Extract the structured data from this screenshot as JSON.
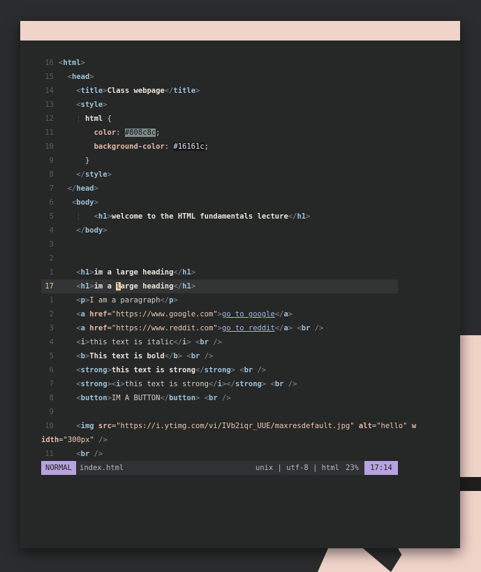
{
  "statusbar": {
    "mode": "NORMAL",
    "filename": "index.html",
    "fileinfo": "unix | utf-8 | html",
    "percent": "23%",
    "position": "17:14"
  },
  "lines": [
    {
      "n": "16",
      "segs": [
        [
          "b",
          "<"
        ],
        [
          "t",
          "html"
        ],
        [
          "b",
          ">"
        ]
      ],
      "indent": 0
    },
    {
      "n": "15",
      "segs": [
        [
          "b",
          "<"
        ],
        [
          "t",
          "head"
        ],
        [
          "b",
          ">"
        ]
      ],
      "indent": 2
    },
    {
      "n": "14",
      "segs": [
        [
          "b",
          "<"
        ],
        [
          "t",
          "title"
        ],
        [
          "b",
          ">"
        ],
        [
          "x",
          "Class webpage"
        ],
        [
          "b",
          "</"
        ],
        [
          "t",
          "title"
        ],
        [
          "b",
          ">"
        ]
      ],
      "indent": 4
    },
    {
      "n": "13",
      "segs": [
        [
          "b",
          "<"
        ],
        [
          "t",
          "style"
        ],
        [
          "b",
          ">"
        ]
      ],
      "indent": 4
    },
    {
      "n": "12",
      "segs": [
        [
          "guide",
          "¦ "
        ],
        [
          "x",
          "html"
        ],
        [
          "p",
          " {"
        ]
      ],
      "indent": 4
    },
    {
      "n": "11",
      "segs": [
        [
          "a",
          "color"
        ],
        [
          "p",
          ": "
        ],
        [
          "gray-hl",
          "#808c8c"
        ],
        [
          "p",
          ";"
        ]
      ],
      "indent": 8
    },
    {
      "n": "10",
      "segs": [
        [
          "a",
          "background-color"
        ],
        [
          "p",
          ": "
        ],
        [
          "dark-hl",
          "#16161c"
        ],
        [
          "p",
          ";"
        ]
      ],
      "indent": 8
    },
    {
      "n": "9",
      "segs": [
        [
          "p",
          "}"
        ]
      ],
      "indent": 6
    },
    {
      "n": "8",
      "segs": [
        [
          "b",
          "</"
        ],
        [
          "t",
          "style"
        ],
        [
          "b",
          ">"
        ]
      ],
      "indent": 4
    },
    {
      "n": "7",
      "segs": [
        [
          "b",
          "</"
        ],
        [
          "t",
          "head"
        ],
        [
          "b",
          ">"
        ]
      ],
      "indent": 2
    },
    {
      "n": "6",
      "segs": [
        [
          "b",
          "<"
        ],
        [
          "t",
          "body"
        ],
        [
          "b",
          ">"
        ]
      ],
      "indent": 3
    },
    {
      "n": "5",
      "segs": [
        [
          "guide",
          "¦   "
        ],
        [
          "b",
          "<"
        ],
        [
          "t",
          "h1"
        ],
        [
          "b",
          ">"
        ],
        [
          "x",
          "welcome to the HTML fundamentals lecture"
        ],
        [
          "b",
          "</"
        ],
        [
          "t",
          "h1"
        ],
        [
          "b",
          ">"
        ]
      ],
      "indent": 4
    },
    {
      "n": "4",
      "segs": [
        [
          "b",
          "</"
        ],
        [
          "t",
          "body"
        ],
        [
          "b",
          ">"
        ]
      ],
      "indent": 4
    },
    {
      "n": "3",
      "segs": [],
      "indent": 0
    },
    {
      "n": "2",
      "segs": [],
      "indent": 0
    },
    {
      "n": "1",
      "segs": [
        [
          "b",
          "<"
        ],
        [
          "t",
          "h1"
        ],
        [
          "b",
          ">"
        ],
        [
          "x",
          "im a large heading"
        ],
        [
          "b",
          "</"
        ],
        [
          "t",
          "h1"
        ],
        [
          "b",
          ">"
        ]
      ],
      "indent": 4
    },
    {
      "n": "17",
      "cur": true,
      "segs": [
        [
          "b",
          "<"
        ],
        [
          "t",
          "h1"
        ],
        [
          "b",
          ">"
        ],
        [
          "x",
          "im a "
        ],
        [
          "cursor",
          "l"
        ],
        [
          "x",
          "arge heading"
        ],
        [
          "b",
          "</"
        ],
        [
          "t",
          "h1"
        ],
        [
          "b",
          ">"
        ]
      ],
      "indent": 4
    },
    {
      "n": "1",
      "segs": [
        [
          "b",
          "<"
        ],
        [
          "t",
          "p"
        ],
        [
          "b",
          ">"
        ],
        [
          "p",
          "I am a paragraph"
        ],
        [
          "b",
          "</"
        ],
        [
          "t",
          "p"
        ],
        [
          "b",
          ">"
        ]
      ],
      "indent": 4
    },
    {
      "n": "2",
      "segs": [
        [
          "b",
          "<"
        ],
        [
          "t",
          "a "
        ],
        [
          "a",
          "href"
        ],
        [
          "p",
          "="
        ],
        [
          "s",
          "\"https://www.google.com\""
        ],
        [
          "b",
          ">"
        ],
        [
          "lk",
          "go to google"
        ],
        [
          "b",
          "</"
        ],
        [
          "t",
          "a"
        ],
        [
          "b",
          ">"
        ]
      ],
      "indent": 4
    },
    {
      "n": "3",
      "segs": [
        [
          "b",
          "<"
        ],
        [
          "t",
          "a "
        ],
        [
          "a",
          "href"
        ],
        [
          "p",
          "="
        ],
        [
          "s",
          "\"https://www.reddit.com\""
        ],
        [
          "b",
          ">"
        ],
        [
          "lk",
          "go to reddit"
        ],
        [
          "b",
          "</"
        ],
        [
          "t",
          "a"
        ],
        [
          "b",
          "> "
        ],
        [
          "b",
          "<"
        ],
        [
          "t",
          "br"
        ],
        [
          "b",
          " />"
        ]
      ],
      "indent": 4
    },
    {
      "n": "4",
      "segs": [
        [
          "b",
          "<"
        ],
        [
          "t",
          "i"
        ],
        [
          "b",
          ">"
        ],
        [
          "p",
          "this text is italic"
        ],
        [
          "b",
          "</"
        ],
        [
          "t",
          "i"
        ],
        [
          "b",
          "> "
        ],
        [
          "b",
          "<"
        ],
        [
          "t",
          "br"
        ],
        [
          "b",
          " />"
        ]
      ],
      "indent": 4
    },
    {
      "n": "5",
      "segs": [
        [
          "b",
          "<"
        ],
        [
          "t",
          "b"
        ],
        [
          "b",
          ">"
        ],
        [
          "x",
          "This text is bold"
        ],
        [
          "b",
          "</"
        ],
        [
          "t",
          "b"
        ],
        [
          "b",
          "> "
        ],
        [
          "b",
          "<"
        ],
        [
          "t",
          "br"
        ],
        [
          "b",
          " />"
        ]
      ],
      "indent": 4
    },
    {
      "n": "6",
      "segs": [
        [
          "b",
          "<"
        ],
        [
          "t",
          "strong"
        ],
        [
          "b",
          ">"
        ],
        [
          "x",
          "this text is strong"
        ],
        [
          "b",
          "</"
        ],
        [
          "t",
          "strong"
        ],
        [
          "b",
          "> "
        ],
        [
          "b",
          "<"
        ],
        [
          "t",
          "br"
        ],
        [
          "b",
          " />"
        ]
      ],
      "indent": 4
    },
    {
      "n": "7",
      "segs": [
        [
          "b",
          "<"
        ],
        [
          "t",
          "strong"
        ],
        [
          "b",
          "><"
        ],
        [
          "t",
          "i"
        ],
        [
          "b",
          ">"
        ],
        [
          "p",
          "this text is strong"
        ],
        [
          "b",
          "</"
        ],
        [
          "t",
          "i"
        ],
        [
          "b",
          "></"
        ],
        [
          "t",
          "strong"
        ],
        [
          "b",
          "> "
        ],
        [
          "b",
          "<"
        ],
        [
          "t",
          "br"
        ],
        [
          "b",
          " />"
        ]
      ],
      "indent": 4
    },
    {
      "n": "8",
      "segs": [
        [
          "b",
          "<"
        ],
        [
          "t",
          "button"
        ],
        [
          "b",
          ">"
        ],
        [
          "p",
          "IM A BUTTON"
        ],
        [
          "b",
          "</"
        ],
        [
          "t",
          "button"
        ],
        [
          "b",
          "> "
        ],
        [
          "b",
          "<"
        ],
        [
          "t",
          "br"
        ],
        [
          "b",
          " />"
        ]
      ],
      "indent": 4
    },
    {
      "n": "9",
      "segs": [],
      "indent": 0
    },
    {
      "n": "10",
      "segs": [
        [
          "b",
          "<"
        ],
        [
          "t",
          "img "
        ],
        [
          "a",
          "src"
        ],
        [
          "p",
          "="
        ],
        [
          "s",
          "\"https://i.ytimg.com/vi/IVb2iqr_UUE/maxresdefault.jpg\""
        ],
        [
          "p",
          " "
        ],
        [
          "a",
          "alt"
        ],
        [
          "p",
          "="
        ],
        [
          "s",
          "\"hello\""
        ],
        [
          "p",
          " "
        ],
        [
          "a",
          "w"
        ]
      ],
      "indent": 4
    },
    {
      "n": "",
      "wrap": true,
      "segs": [
        [
          "a",
          "idth"
        ],
        [
          "p",
          "="
        ],
        [
          "s",
          "\"300px\""
        ],
        [
          "b",
          " />"
        ]
      ],
      "indent": 0
    },
    {
      "n": "11",
      "segs": [
        [
          "b",
          "<"
        ],
        [
          "t",
          "br"
        ],
        [
          "b",
          " />"
        ]
      ],
      "indent": 4
    }
  ]
}
